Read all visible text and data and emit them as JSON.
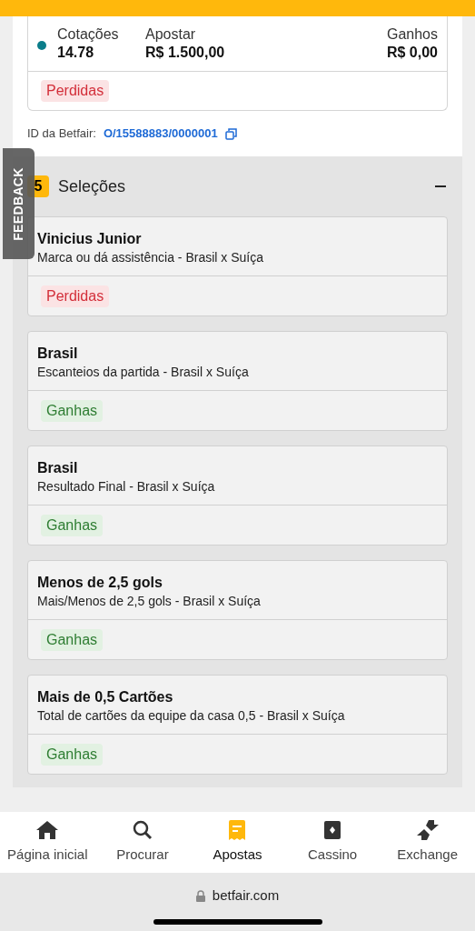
{
  "bet": {
    "odds_label": "Cotações",
    "odds": "14.78",
    "stake_label": "Apostar",
    "stake": "R$ 1.500,00",
    "returns_label": "Ganhos",
    "returns": "R$ 0,00",
    "status": {
      "label": "Perdidas",
      "kind": "lost"
    }
  },
  "bet_id": {
    "label": "ID da Betfair:",
    "value": "O/15588883/0000001"
  },
  "selections": {
    "count": "5",
    "title": "Seleções",
    "expanded": true,
    "items": [
      {
        "name": "Vinicius Junior",
        "market": "Marca ou dá assistência - Brasil x Suíça",
        "status": {
          "label": "Perdidas",
          "kind": "lost"
        }
      },
      {
        "name": "Brasil",
        "market": "Escanteios da partida - Brasil x Suíça",
        "status": {
          "label": "Ganhas",
          "kind": "won"
        }
      },
      {
        "name": "Brasil",
        "market": "Resultado Final - Brasil x Suíça",
        "status": {
          "label": "Ganhas",
          "kind": "won"
        }
      },
      {
        "name": "Menos de 2,5 gols",
        "market": "Mais/Menos de 2,5 gols - Brasil x Suíça",
        "status": {
          "label": "Ganhas",
          "kind": "won"
        }
      },
      {
        "name": "Mais de 0,5 Cartões",
        "market": "Total de cartões da equipe da casa 0,5 - Brasil x Suíça",
        "status": {
          "label": "Ganhas",
          "kind": "won"
        }
      }
    ]
  },
  "feedback": "FEEDBACK",
  "nav": [
    {
      "label": "Página inicial",
      "kind": "home",
      "selected": false
    },
    {
      "label": "Procurar",
      "kind": "search",
      "selected": false
    },
    {
      "label": "Apostas",
      "kind": "bets",
      "selected": true
    },
    {
      "label": "Cassino",
      "kind": "casino",
      "selected": false
    },
    {
      "label": "Exchange",
      "kind": "exchange",
      "selected": false
    }
  ],
  "url": "betfair.com"
}
